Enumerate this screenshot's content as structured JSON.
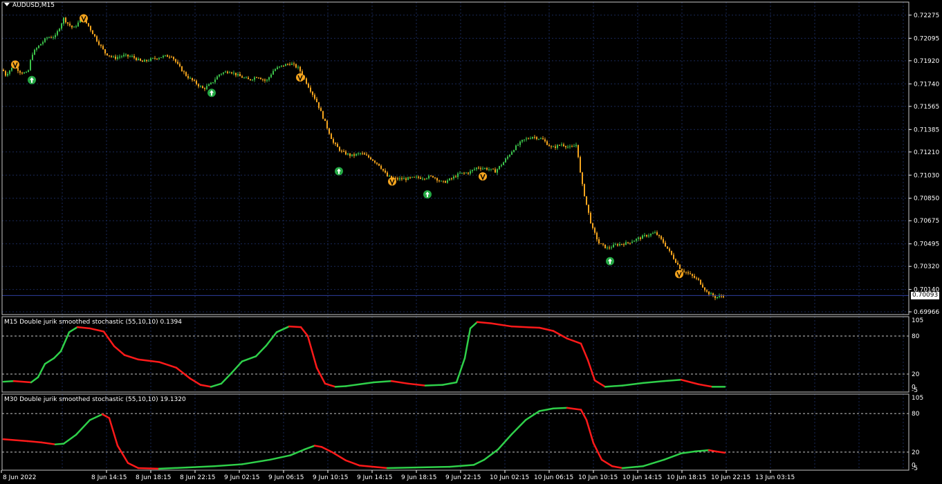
{
  "chart_title": "AUDUSD,M15",
  "colors": {
    "background": "#000000",
    "grid": "#1a2a5a",
    "bull": "#3cc24a",
    "bear": "#f5a51e",
    "osc_up": "#2fd04a",
    "osc_down": "#ff1a1a",
    "signal_buy": "#24a844",
    "signal_sell": "#f5a51e"
  },
  "icons": {
    "signal_buy": "up-arrow-circle-icon",
    "signal_sell": "down-arrow-circle-icon",
    "title_menu": "triangle-down-icon"
  },
  "current_price": "0.70093",
  "price_axis_labels": [
    "0.72275",
    "0.72095",
    "0.71920",
    "0.71740",
    "0.71565",
    "0.71385",
    "0.71210",
    "0.71030",
    "0.70850",
    "0.70675",
    "0.70495",
    "0.70320",
    "0.70140",
    "0.69966"
  ],
  "time_axis_labels": [
    "8 Jun 2022",
    "8 Jun 14:15",
    "8 Jun 18:15",
    "8 Jun 22:15",
    "9 Jun 02:15",
    "9 Jun 06:15",
    "9 Jun 10:15",
    "9 Jun 14:15",
    "9 Jun 18:15",
    "9 Jun 22:15",
    "10 Jun 02:15",
    "10 Jun 06:15",
    "10 Jun 10:15",
    "10 Jun 14:15",
    "10 Jun 18:15",
    "10 Jun 22:15",
    "13 Jun 03:15"
  ],
  "indicator_panes": [
    {
      "title": "M15 Double jurik smoothed stochastic (55,10,10) 0.1394",
      "levels": [
        "105",
        "80",
        "20",
        "0",
        "-5"
      ],
      "ylim": [
        -5,
        105
      ],
      "dashed_levels": [
        80,
        20
      ]
    },
    {
      "title": "M30 Double jurik smoothed stochastic (55,10,10) 19.1320",
      "levels": [
        "105",
        "80",
        "20",
        "0",
        "-5"
      ],
      "ylim": [
        -5,
        105
      ],
      "dashed_levels": [
        80,
        20
      ]
    }
  ],
  "chart_data": [
    {
      "type": "candlestick",
      "title": "AUDUSD,M15",
      "ylim": [
        0.69966,
        0.72355
      ],
      "price_path": [
        [
          0,
          0.7189
        ],
        [
          8,
          0.7181
        ],
        [
          20,
          0.7188
        ],
        [
          30,
          0.7183
        ],
        [
          40,
          0.7182
        ],
        [
          46,
          0.7197
        ],
        [
          55,
          0.7203
        ],
        [
          68,
          0.721
        ],
        [
          80,
          0.7211
        ],
        [
          92,
          0.7225
        ],
        [
          98,
          0.7221
        ],
        [
          106,
          0.7217
        ],
        [
          114,
          0.7222
        ],
        [
          120,
          0.7225
        ],
        [
          128,
          0.7219
        ],
        [
          140,
          0.7208
        ],
        [
          152,
          0.7198
        ],
        [
          165,
          0.7194
        ],
        [
          178,
          0.7196
        ],
        [
          192,
          0.7195
        ],
        [
          205,
          0.7191
        ],
        [
          218,
          0.7193
        ],
        [
          232,
          0.7195
        ],
        [
          248,
          0.7196
        ],
        [
          258,
          0.7188
        ],
        [
          270,
          0.718
        ],
        [
          282,
          0.7175
        ],
        [
          294,
          0.717
        ],
        [
          305,
          0.7174
        ],
        [
          318,
          0.7182
        ],
        [
          332,
          0.7184
        ],
        [
          346,
          0.718
        ],
        [
          360,
          0.7177
        ],
        [
          372,
          0.718
        ],
        [
          385,
          0.7176
        ],
        [
          396,
          0.7185
        ],
        [
          408,
          0.7188
        ],
        [
          420,
          0.719
        ],
        [
          432,
          0.7186
        ],
        [
          446,
          0.7172
        ],
        [
          458,
          0.716
        ],
        [
          470,
          0.7144
        ],
        [
          482,
          0.7128
        ],
        [
          494,
          0.7121
        ],
        [
          508,
          0.7118
        ],
        [
          522,
          0.712
        ],
        [
          536,
          0.7116
        ],
        [
          548,
          0.7111
        ],
        [
          560,
          0.7102
        ],
        [
          572,
          0.71
        ],
        [
          586,
          0.71
        ],
        [
          600,
          0.7101
        ],
        [
          612,
          0.7101
        ],
        [
          626,
          0.7102
        ],
        [
          640,
          0.7097
        ],
        [
          652,
          0.71
        ],
        [
          664,
          0.7104
        ],
        [
          678,
          0.7105
        ],
        [
          690,
          0.7109
        ],
        [
          704,
          0.7108
        ],
        [
          716,
          0.7106
        ],
        [
          728,
          0.7113
        ],
        [
          742,
          0.7123
        ],
        [
          756,
          0.713
        ],
        [
          770,
          0.7133
        ],
        [
          784,
          0.7131
        ],
        [
          798,
          0.7124
        ],
        [
          812,
          0.7127
        ],
        [
          826,
          0.7124
        ],
        [
          834,
          0.7127
        ],
        [
          840,
          0.71
        ],
        [
          848,
          0.708
        ],
        [
          856,
          0.7062
        ],
        [
          866,
          0.705
        ],
        [
          878,
          0.7046
        ],
        [
          892,
          0.7049
        ],
        [
          906,
          0.705
        ],
        [
          920,
          0.7053
        ],
        [
          934,
          0.7056
        ],
        [
          948,
          0.7058
        ],
        [
          960,
          0.705
        ],
        [
          972,
          0.704
        ],
        [
          984,
          0.703
        ],
        [
          996,
          0.7026
        ],
        [
          1010,
          0.7021
        ],
        [
          1022,
          0.7012
        ],
        [
          1034,
          0.7008
        ],
        [
          1046,
          0.7009
        ]
      ],
      "signals": [
        {
          "type": "sell",
          "price": 0.7189,
          "bar_x": 22
        },
        {
          "type": "buy",
          "price": 0.7177,
          "bar_x": 46
        },
        {
          "type": "sell",
          "price": 0.7225,
          "bar_x": 121
        },
        {
          "type": "buy",
          "price": 0.7167,
          "bar_x": 306
        },
        {
          "type": "sell",
          "price": 0.7179,
          "bar_x": 434
        },
        {
          "type": "buy",
          "price": 0.7106,
          "bar_x": 490
        },
        {
          "type": "sell",
          "price": 0.7098,
          "bar_x": 567
        },
        {
          "type": "buy",
          "price": 0.7088,
          "bar_x": 618
        },
        {
          "type": "sell",
          "price": 0.7102,
          "bar_x": 698
        },
        {
          "type": "buy",
          "price": 0.7036,
          "bar_x": 882
        },
        {
          "type": "sell",
          "price": 0.7026,
          "bar_x": 982
        }
      ]
    },
    {
      "type": "line",
      "title": "M15 Double jurik smoothed stochastic (55,10,10) 0.1394",
      "ylim": [
        -5,
        105
      ],
      "x_label_positions": "bar_index",
      "values": [
        [
          5,
          8
        ],
        [
          20,
          9
        ],
        [
          45,
          7
        ],
        [
          55,
          15
        ],
        [
          65,
          36
        ],
        [
          78,
          45
        ],
        [
          88,
          56
        ],
        [
          100,
          86
        ],
        [
          112,
          94
        ],
        [
          130,
          92
        ],
        [
          150,
          87
        ],
        [
          165,
          64
        ],
        [
          180,
          50
        ],
        [
          200,
          43
        ],
        [
          230,
          39
        ],
        [
          255,
          30
        ],
        [
          275,
          13
        ],
        [
          290,
          3
        ],
        [
          305,
          0
        ],
        [
          320,
          5
        ],
        [
          335,
          22
        ],
        [
          350,
          40
        ],
        [
          370,
          48
        ],
        [
          385,
          65
        ],
        [
          400,
          86
        ],
        [
          418,
          95
        ],
        [
          435,
          94
        ],
        [
          445,
          80
        ],
        [
          458,
          30
        ],
        [
          470,
          5
        ],
        [
          485,
          0
        ],
        [
          500,
          1
        ],
        [
          520,
          4
        ],
        [
          540,
          7
        ],
        [
          566,
          9
        ],
        [
          590,
          5
        ],
        [
          615,
          2
        ],
        [
          640,
          3
        ],
        [
          660,
          7
        ],
        [
          672,
          45
        ],
        [
          680,
          92
        ],
        [
          690,
          102
        ],
        [
          710,
          100
        ],
        [
          740,
          95
        ],
        [
          780,
          93
        ],
        [
          800,
          88
        ],
        [
          820,
          76
        ],
        [
          840,
          68
        ],
        [
          850,
          42
        ],
        [
          860,
          10
        ],
        [
          875,
          0
        ],
        [
          900,
          2
        ],
        [
          930,
          6
        ],
        [
          960,
          9
        ],
        [
          985,
          11
        ],
        [
          1010,
          4
        ],
        [
          1030,
          0
        ],
        [
          1048,
          0
        ]
      ],
      "segments_color_rule": "green when rising, red when falling"
    },
    {
      "type": "line",
      "title": "M30 Double jurik smoothed stochastic (55,10,10) 19.1320",
      "ylim": [
        -5,
        105
      ],
      "values": [
        [
          5,
          40
        ],
        [
          40,
          37
        ],
        [
          60,
          35
        ],
        [
          80,
          32
        ],
        [
          92,
          33
        ],
        [
          110,
          47
        ],
        [
          130,
          70
        ],
        [
          148,
          79
        ],
        [
          158,
          73
        ],
        [
          170,
          30
        ],
        [
          185,
          3
        ],
        [
          200,
          -5
        ],
        [
          230,
          -6
        ],
        [
          270,
          -4
        ],
        [
          310,
          -2
        ],
        [
          350,
          1
        ],
        [
          390,
          8
        ],
        [
          420,
          15
        ],
        [
          440,
          24
        ],
        [
          455,
          30
        ],
        [
          465,
          28
        ],
        [
          480,
          20
        ],
        [
          500,
          7
        ],
        [
          520,
          -1
        ],
        [
          560,
          -5
        ],
        [
          600,
          -4
        ],
        [
          650,
          -3
        ],
        [
          685,
          0
        ],
        [
          700,
          8
        ],
        [
          720,
          24
        ],
        [
          740,
          48
        ],
        [
          760,
          70
        ],
        [
          780,
          84
        ],
        [
          800,
          88
        ],
        [
          820,
          89
        ],
        [
          840,
          86
        ],
        [
          848,
          70
        ],
        [
          858,
          34
        ],
        [
          870,
          8
        ],
        [
          885,
          -2
        ],
        [
          900,
          -5
        ],
        [
          930,
          -2
        ],
        [
          960,
          8
        ],
        [
          985,
          18
        ],
        [
          1005,
          21
        ],
        [
          1025,
          23
        ],
        [
          1035,
          21
        ],
        [
          1048,
          19
        ]
      ],
      "segments_color_rule": "green when rising, red when falling"
    }
  ]
}
